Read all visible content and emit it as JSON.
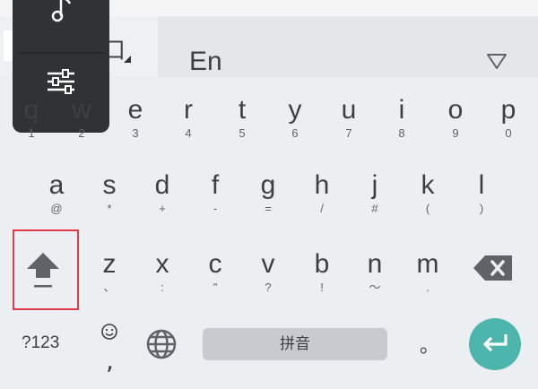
{
  "toolbar": {
    "mode_glyph": "口",
    "language": "En"
  },
  "keys": {
    "row1": [
      {
        "main": "q",
        "sub": "1"
      },
      {
        "main": "w",
        "sub": "2"
      },
      {
        "main": "e",
        "sub": "3"
      },
      {
        "main": "r",
        "sub": "4"
      },
      {
        "main": "t",
        "sub": "5"
      },
      {
        "main": "y",
        "sub": "6"
      },
      {
        "main": "u",
        "sub": "7"
      },
      {
        "main": "i",
        "sub": "8"
      },
      {
        "main": "o",
        "sub": "9"
      },
      {
        "main": "p",
        "sub": "0"
      }
    ],
    "row2": [
      {
        "main": "a",
        "sub": "@"
      },
      {
        "main": "s",
        "sub": "*"
      },
      {
        "main": "d",
        "sub": "+"
      },
      {
        "main": "f",
        "sub": "-"
      },
      {
        "main": "g",
        "sub": "="
      },
      {
        "main": "h",
        "sub": "/"
      },
      {
        "main": "j",
        "sub": "#"
      },
      {
        "main": "k",
        "sub": "("
      },
      {
        "main": "l",
        "sub": ")"
      }
    ],
    "row3": [
      {
        "main": "z",
        "sub": "、"
      },
      {
        "main": "x",
        "sub": ":"
      },
      {
        "main": "c",
        "sub": "\""
      },
      {
        "main": "v",
        "sub": "?"
      },
      {
        "main": "b",
        "sub": "!"
      },
      {
        "main": "n",
        "sub": "〜"
      },
      {
        "main": "m",
        "sub": "."
      }
    ]
  },
  "bottom": {
    "symbols_label": "?123",
    "comma": ",",
    "space_label": "拼音",
    "period": "。"
  },
  "colors": {
    "background": "#eceff1",
    "enter_accent": "#4db6ac",
    "highlight_box": "#e03a4b",
    "popup": "#2f3336"
  },
  "icons": [
    "music-note-icon",
    "equalizer-icon",
    "collapse-triangle-icon",
    "shift-icon",
    "backspace-icon",
    "emoji-icon",
    "globe-icon",
    "enter-icon"
  ]
}
